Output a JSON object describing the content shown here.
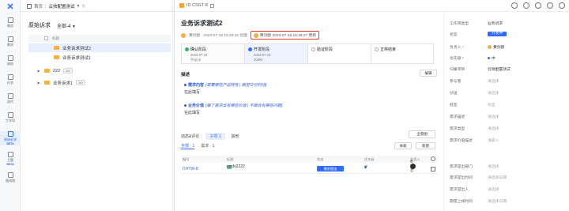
{
  "rail": {
    "items": [
      {
        "label": "概览",
        "icon": "overview-icon"
      },
      {
        "label": "需求",
        "icon": "requirement-icon"
      },
      {
        "label": "缺陷",
        "icon": "bug-icon"
      },
      {
        "label": "任务",
        "icon": "task-icon"
      },
      {
        "label": "迭代",
        "icon": "iteration-icon"
      },
      {
        "label": "工作项",
        "icon": "workitem-icon"
      },
      {
        "label": "原始诉求",
        "icon": "original-request-icon",
        "beta": "BETA"
      },
      {
        "label": "主题",
        "icon": "theme-icon",
        "beta": "BETA"
      },
      {
        "label": "路线图",
        "icon": "roadmap-icon"
      }
    ]
  },
  "topbar": {
    "home": "首页",
    "project": "云效配置测试"
  },
  "list": {
    "title": "原始诉求",
    "filter": "全部-4",
    "col_title": "标题",
    "rows": [
      {
        "label": "业务诉求测试2",
        "selected": true,
        "expander": false
      },
      {
        "label": "业务诉求测试1",
        "selected": false,
        "expander": false
      },
      {
        "label": "222",
        "tag": "0/1",
        "selected": false,
        "expander": true
      },
      {
        "label": "业务诉求1",
        "tag": "1/0",
        "selected": false,
        "expander": true
      }
    ]
  },
  "drawer": {
    "id": "ID CSGT-8",
    "title": "业务诉求测试2",
    "creator": "黄剑醇",
    "created": "2023-07-18 15:26:16 创建",
    "updated": "黄剑醇 2023-07-18 15:36:27 更新",
    "stages": [
      {
        "name": "确认阶段",
        "date": "2023-07-18",
        "duration": "不足1h",
        "state": "done"
      },
      {
        "name": "开发阶段",
        "date": "2023-07-18",
        "duration": "10d0h",
        "state": "current"
      },
      {
        "name": "验证阶段",
        "date": "",
        "duration": "",
        "state": "todo"
      },
      {
        "name": "正常结束",
        "date": "",
        "duration": "",
        "state": "todo"
      }
    ],
    "desc_label": "描述",
    "edit_label": "编辑",
    "desc": [
      {
        "title": "需求内容",
        "hint": "(需要哪些产品特性 | 期望交付时间)",
        "value": "在此填写"
      },
      {
        "title": "业务价值",
        "hint": "(解了需求会有哪些价值 | 不做会有哪些问题)",
        "value": "在此填写"
      }
    ],
    "tabs": [
      "动态&评论",
      "子项 1",
      "其他"
    ],
    "all_view": "全景图",
    "subtabs": [
      "全部 · 1",
      "需求 · 1"
    ],
    "btn_relate": "关联",
    "btn_new": "新建",
    "table": {
      "headers": [
        "编号",
        "标题",
        "状态",
        "优先级",
        "负责人"
      ],
      "rows": [
        {
          "code": "DHYW-8",
          "title": "ceshi2222",
          "status": "需求提出",
          "priority": "中",
          "owner": "赵文哲"
        }
      ]
    }
  },
  "props": [
    {
      "key": "工作项类型",
      "value": "业务诉求",
      "style": "text"
    },
    {
      "key": "状态",
      "value": "开发中",
      "style": "badge"
    },
    {
      "key": "负责人 *",
      "value": "黄剑醇",
      "style": "avatar"
    },
    {
      "key": "优先级 *",
      "value": "中",
      "style": "dot"
    },
    {
      "key": "归属项目",
      "value": "云效配置测试",
      "style": "text"
    },
    {
      "key": "参与者",
      "value": "请选择",
      "style": "ph"
    },
    {
      "key": "抄送",
      "value": "请选择",
      "style": "ph"
    },
    {
      "key": "标签",
      "value": "标签",
      "style": "ph"
    },
    {
      "key": "需求描述",
      "value": "请选择",
      "style": "ph"
    },
    {
      "key": "需求类型",
      "value": "请选择",
      "style": "ph"
    },
    {
      "key": "需求价值描述",
      "value": "请输入",
      "style": "ph"
    },
    {
      "key": "需求提出部门",
      "value": "请选择",
      "style": "ph"
    },
    {
      "key": "需求提出时间",
      "value": "请选择日期",
      "style": "ph"
    },
    {
      "key": "需求提出人",
      "value": "请选择",
      "style": "ph"
    },
    {
      "key": "期望上线时间",
      "value": "请选择日期",
      "style": "ph"
    }
  ],
  "colors": {
    "accent": "#2f6bff",
    "highlight": "#e53935",
    "folder": "#f5b23d"
  }
}
